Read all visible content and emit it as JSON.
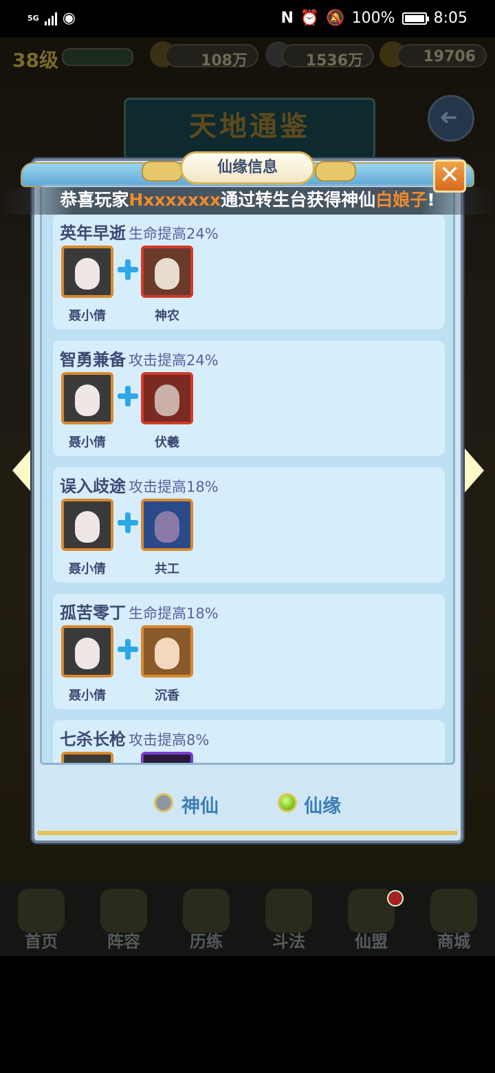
{
  "status_bar": {
    "network": "5G",
    "battery": "100%",
    "battery_fraction": 1.0,
    "time": "8:05",
    "icons": [
      "signal-icon",
      "eye-icon",
      "nfc-icon",
      "alarm-icon",
      "mute-icon",
      "battery-icon"
    ]
  },
  "hud": {
    "level": "38级",
    "resource_1": "108万",
    "resource_2": "1536万",
    "resource_3": "19706"
  },
  "page_banner": "天地通鉴",
  "modal": {
    "title": "仙缘信息",
    "close": "✕",
    "ticker": {
      "prefix": "恭喜玩家",
      "player": "Hxxxxxxx",
      "middle": "通过转生台获得神仙",
      "reward": "白娘子",
      "suffix": "!"
    },
    "bonds": [
      {
        "name": "英年早逝",
        "effect": "生命提高24%",
        "hero1": "聂小倩",
        "hero2": "神农",
        "hero2_frame": "red"
      },
      {
        "name": "智勇兼备",
        "effect": "攻击提高24%",
        "hero1": "聂小倩",
        "hero2": "伏羲",
        "hero2_frame": "red"
      },
      {
        "name": "误入歧途",
        "effect": "攻击提高18%",
        "hero1": "聂小倩",
        "hero2": "共工",
        "hero2_frame": "orange"
      },
      {
        "name": "孤苦零丁",
        "effect": "生命提高18%",
        "hero1": "聂小倩",
        "hero2": "沉香",
        "hero2_frame": "orange"
      },
      {
        "name": "七杀长枪",
        "effect": "攻击提高8%",
        "hero1": "",
        "hero2": "",
        "hero2_frame": "purple"
      }
    ],
    "tabs": [
      {
        "label": "神仙",
        "selected": false
      },
      {
        "label": "仙缘",
        "selected": true
      }
    ]
  },
  "bottom_nav": [
    "首页",
    "阵容",
    "历练",
    "斗法",
    "仙盟",
    "商城"
  ],
  "colors": {
    "panel_bg": "#cfe6f4",
    "card_bg": "#d6edfb",
    "title_text": "#3c4a73",
    "effect_text": "#5a5f9a",
    "highlight_orange": "#f28a2b",
    "plus_blue": "#2ea7e6",
    "tab_text": "#3d7fb6"
  }
}
